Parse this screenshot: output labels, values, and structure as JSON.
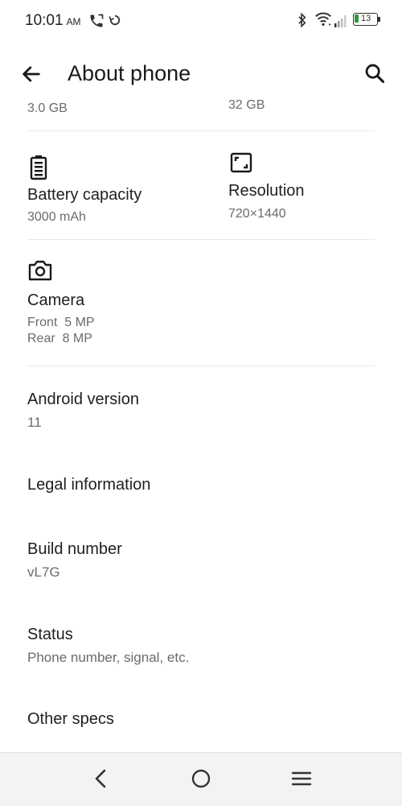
{
  "status": {
    "time": "10:01",
    "ampm": "AM",
    "battery": "13"
  },
  "toolbar": {
    "title": "About phone"
  },
  "storage": {
    "ram_value": "3.0 GB",
    "rom_value": "32 GB"
  },
  "battery_item": {
    "label": "Battery capacity",
    "value": "3000 mAh"
  },
  "resolution_item": {
    "label": "Resolution",
    "value": "720×1440"
  },
  "camera_item": {
    "label": "Camera",
    "front": "Front  5 MP",
    "rear": "Rear  8 MP"
  },
  "list": [
    {
      "label": "Android version",
      "value": "11"
    },
    {
      "label": "Legal information"
    },
    {
      "label": "Build number",
      "value": "vL7G"
    },
    {
      "label": "Status",
      "value": "Phone number, signal, etc."
    },
    {
      "label": "Other specs"
    }
  ],
  "icons": {
    "back": "arrow-back-icon",
    "search": "search-icon",
    "battery": "battery-icon",
    "resolution": "resolution-icon",
    "camera": "camera-icon"
  }
}
